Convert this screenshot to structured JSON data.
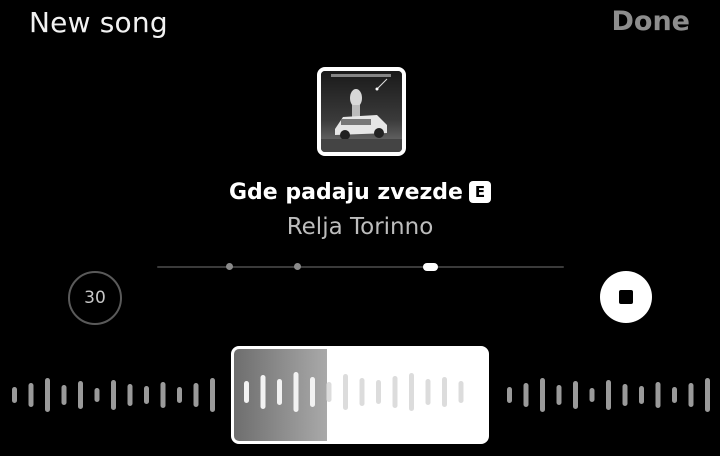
{
  "header": {
    "title": "New song",
    "done_label": "Done"
  },
  "track": {
    "title": "Gde padaju zvezde",
    "explicit_badge": "E",
    "artist": "Relja Torinno",
    "cover_icon": "album-art"
  },
  "controls": {
    "duration_label": "30",
    "stop_icon": "stop-icon"
  },
  "selection": {
    "played_fraction": 0.37
  },
  "colors": {
    "background": "#000000",
    "done_disabled": "#8d8d8d",
    "artist_text": "#bdbdbd"
  }
}
